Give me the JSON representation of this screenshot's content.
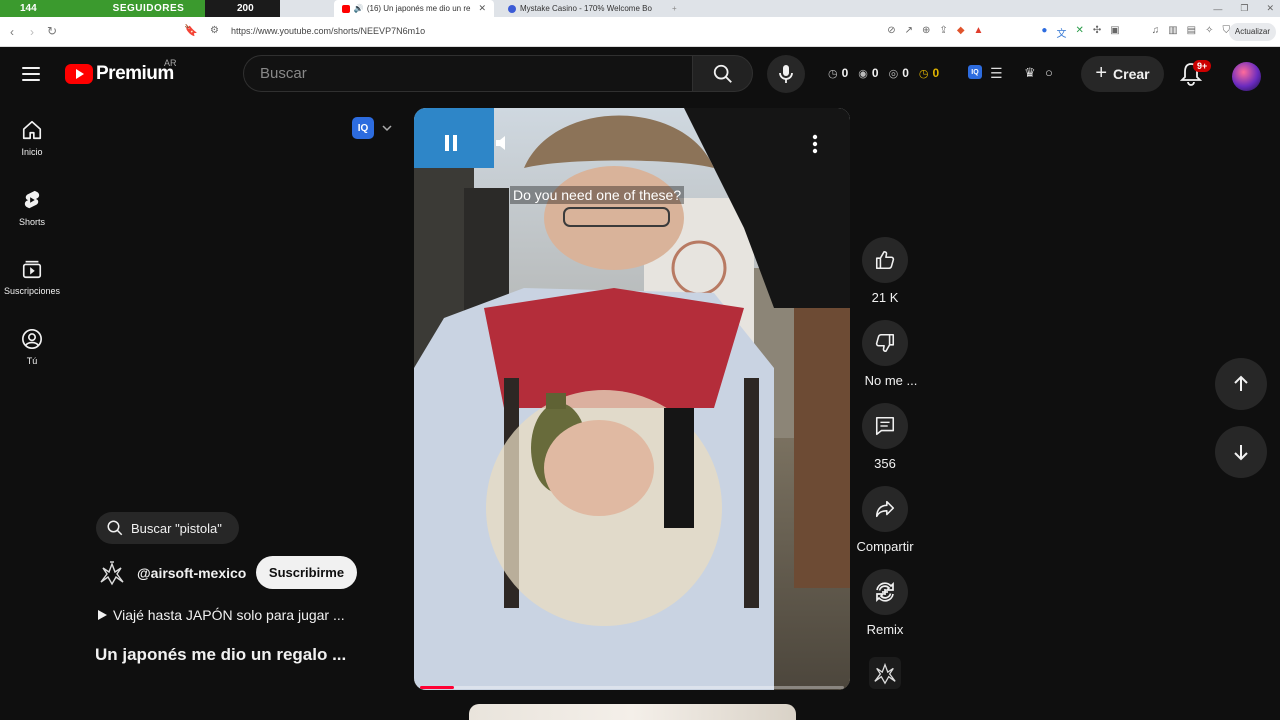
{
  "browser": {
    "stream_overlay": {
      "left_count": "144",
      "label": "SEGUIDORES",
      "right_count": "200"
    },
    "tabs": [
      {
        "label": "(16) Un japonés me dio un re",
        "active": true
      },
      {
        "label": "Mystake Casino - 170% Welcome Bo",
        "active": false
      }
    ],
    "url": "https://www.youtube.com/shorts/NEEVP7N6m1o",
    "update_label": "Actualizar"
  },
  "header": {
    "logo_text": "Premium",
    "country": "AR",
    "search_placeholder": "Buscar",
    "stats": [
      {
        "icon": "clock-icon",
        "value": "0"
      },
      {
        "icon": "eye-icon",
        "value": "0"
      },
      {
        "icon": "eye-outline-icon",
        "value": "0"
      },
      {
        "icon": "gold-clock-icon",
        "value": "0"
      }
    ],
    "create_label": "Crear",
    "notifications_badge": "9+"
  },
  "sidebar": {
    "items": [
      {
        "label": "Inicio",
        "icon": "home-icon"
      },
      {
        "label": "Shorts",
        "icon": "shorts-icon"
      },
      {
        "label": "Suscripciones",
        "icon": "subscriptions-icon"
      },
      {
        "label": "Tú",
        "icon": "you-icon"
      }
    ]
  },
  "short": {
    "search_suggestion": "Buscar \"pistola\"",
    "channel": "@airsoft-mexico",
    "subscribe_label": "Suscribirme",
    "related_video": "Viajé hasta JAPÓN solo para jugar ...",
    "title": "Un japonés me dio un regalo ...",
    "caption": "Do you need one of these?",
    "progress": 0.08
  },
  "actions": {
    "like_count": "21 K",
    "dislike_label": "No me ...",
    "comments_count": "356",
    "share_label": "Compartir",
    "remix_label": "Remix"
  },
  "colors": {
    "background": "#0f0f0f",
    "brand_red": "#ff0000",
    "progress_red": "#ff0033",
    "chip": "#272727"
  }
}
